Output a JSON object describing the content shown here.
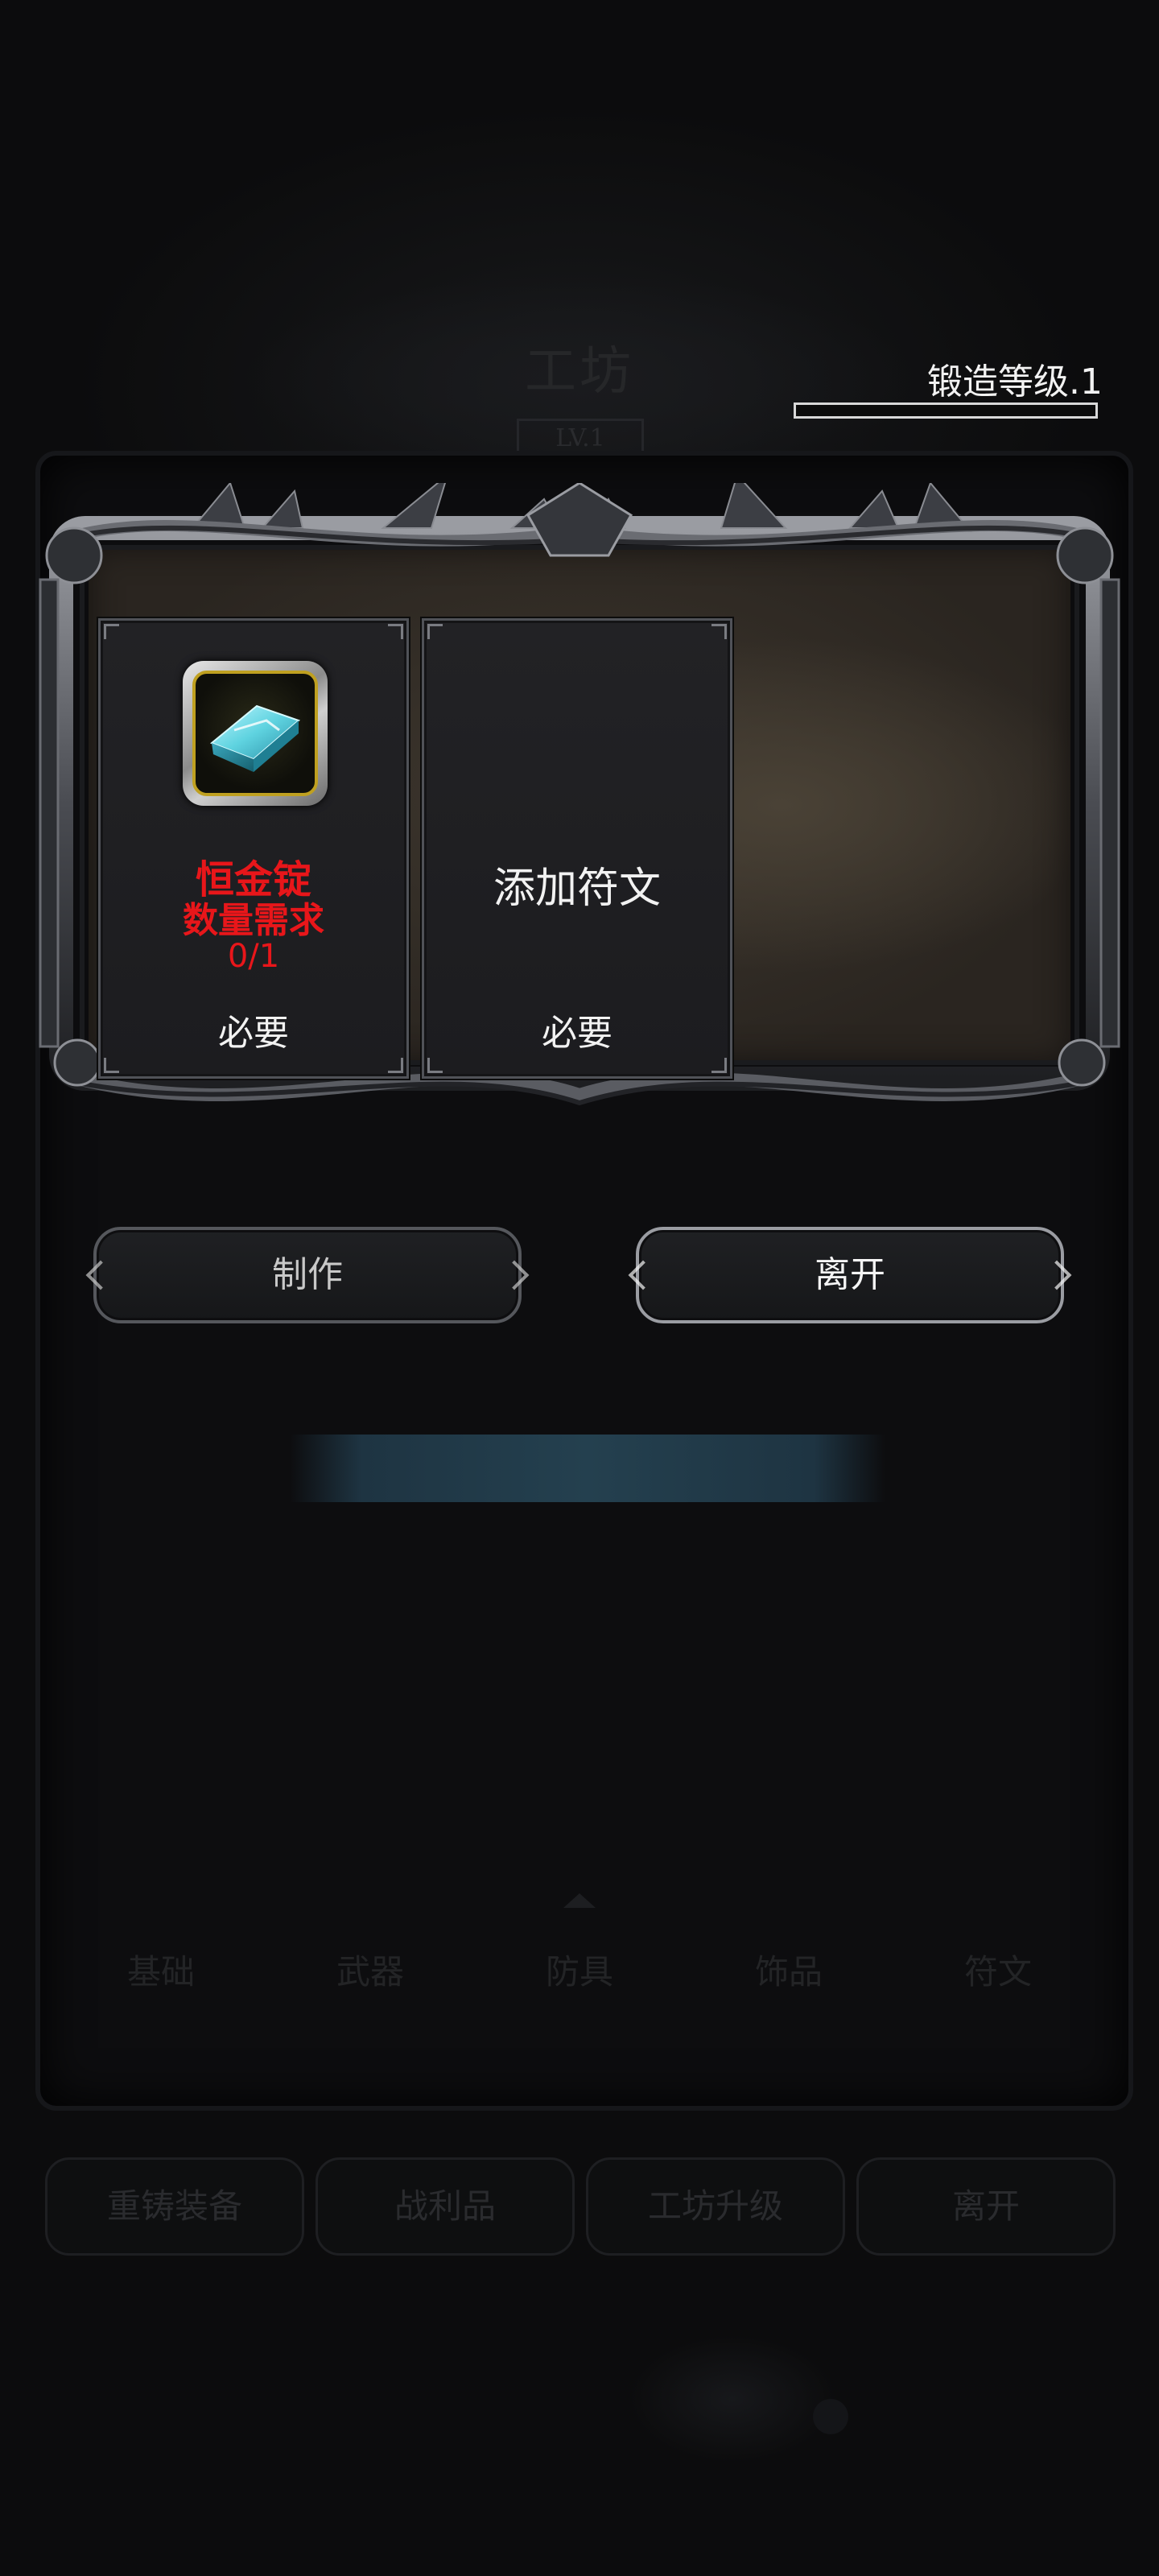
{
  "background": {
    "workshop_title": "工坊",
    "workshop_level": "LV.1",
    "tabs": [
      "基础",
      "武器",
      "防具",
      "饰品",
      "符文"
    ],
    "buttons": [
      "重铸装备",
      "战利品",
      "工坊升级",
      "离开"
    ]
  },
  "forge": {
    "level_label": "锻造等级.1",
    "progress_fraction": 0.0
  },
  "material_slot": {
    "icon": "ingot-icon",
    "name": "恒金锭",
    "requirement_label": "数量需求",
    "count": "0/1",
    "required_label": "必要"
  },
  "rune_slot": {
    "title": "添加符文",
    "required_label": "必要"
  },
  "actions": {
    "craft_label": "制作",
    "leave_label": "离开"
  },
  "colors": {
    "requirement_red": "#e8161a",
    "parchment": "#3e372e",
    "frame_metal": "#6c6e74",
    "ingot_blue": "#5fd3e0",
    "icon_gold": "#bfa020"
  }
}
